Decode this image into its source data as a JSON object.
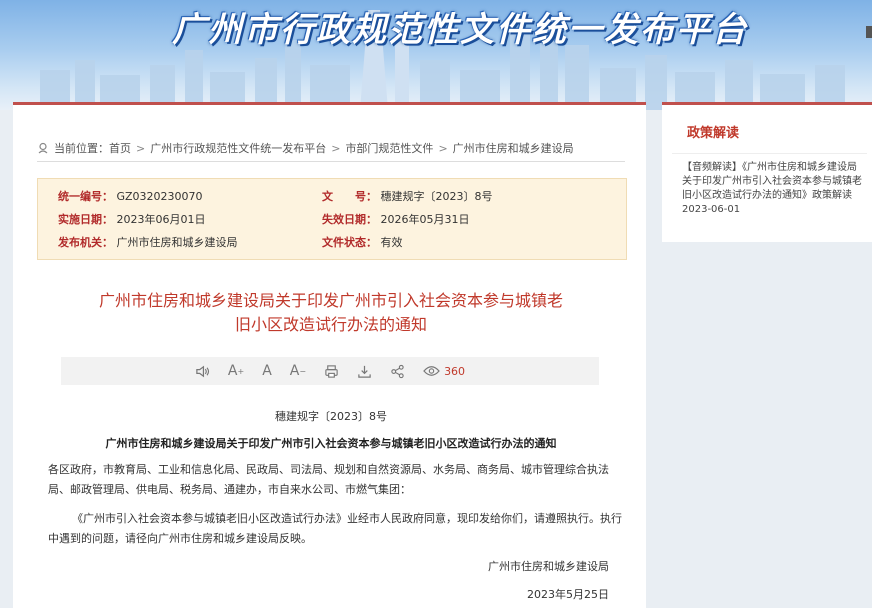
{
  "site": {
    "title": "广州市行政规范性文件统一发布平台"
  },
  "breadcrumb": {
    "prefix": "当前位置：",
    "items": [
      "首页",
      "广州市行政规范性文件统一发布平台",
      "市部门规范性文件",
      "广州市住房和城乡建设局"
    ],
    "separator": ">"
  },
  "meta": {
    "code_label": "统一编号：",
    "code_value": "GZ0320230070",
    "docno_label": "文　　号：",
    "docno_value": "穗建规字〔2023〕8号",
    "impl_label": "实施日期：",
    "impl_value": "2023年06月01日",
    "expire_label": "失效日期：",
    "expire_value": "2026年05月31日",
    "issuer_label": "发布机关：",
    "issuer_value": "广州市住房和城乡建设局",
    "status_label": "文件状态：",
    "status_value": "有效"
  },
  "document": {
    "title_line1": "广州市住房和城乡建设局关于印发广州市引入社会资本参与城镇老",
    "title_line2": "旧小区改造试行办法的通知",
    "number": "穗建规字〔2023〕8号",
    "subtitle": "广州市住房和城乡建设局关于印发广州市引入社会资本参与城镇老旧小区改造试行办法的通知",
    "para1": "各区政府，市教育局、工业和信息化局、民政局、司法局、规划和自然资源局、水务局、商务局、城市管理综合执法局、邮政管理局、供电局、税务局、通建办，市自来水公司、市燃气集团：",
    "para2": "《广州市引入社会资本参与城镇老旧小区改造试行办法》业经市人民政府同意，现印发给你们，请遵照执行。执行中遇到的问题，请径向广州市住房和城乡建设局反映。",
    "signature": "广州市住房和城乡建设局",
    "date": "2023年5月25日"
  },
  "toolbar": {
    "icons": [
      "speaker-icon",
      "font-increase-icon",
      "font-normal-icon",
      "font-decrease-icon",
      "print-icon",
      "download-icon",
      "share-icon",
      "eye-icon"
    ],
    "views": "360"
  },
  "sidebar": {
    "title": "政策解读",
    "item": "【音频解读】《广州市住房和城乡建设局关于印发广州市引入社会资本参与城镇老旧小区改造试行办法的通知》政策解读　2023-06-01"
  },
  "colors": {
    "accent": "#c0392b",
    "meta_bg": "#fdf3df"
  }
}
